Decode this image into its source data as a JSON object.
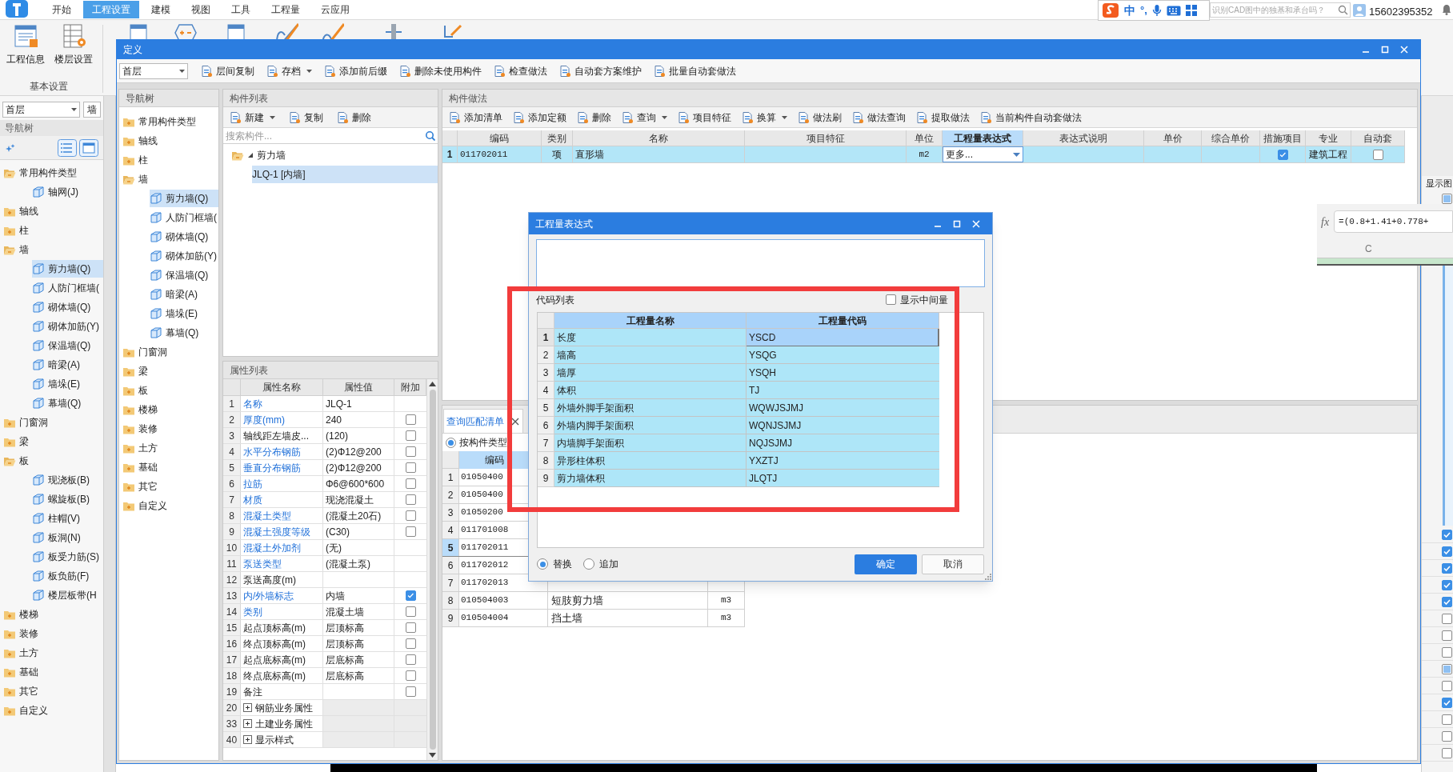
{
  "app": {
    "ribbon_tabs": [
      {
        "label": "开始",
        "selected": false
      },
      {
        "label": "工程设置",
        "selected": true
      },
      {
        "label": "建模",
        "selected": false
      },
      {
        "label": "视图",
        "selected": false
      },
      {
        "label": "工具",
        "selected": false
      },
      {
        "label": "工程量",
        "selected": false
      },
      {
        "label": "云应用",
        "selected": false
      }
    ],
    "ribbon_buttons": [
      {
        "label": "工程信息"
      },
      {
        "label": "楼层设置"
      }
    ],
    "ribbon_group": "基本设置",
    "ime": {
      "language": "中",
      "punctuation": "°,"
    },
    "help_search": {
      "placeholder": "识别CAD图中的独基和承台吗？"
    },
    "user": "15602395352",
    "floor_select": "首层",
    "type_field": "墙",
    "nav_title": "导航树",
    "nav_tree": [
      {
        "label": "常用构件类型",
        "expanded": true,
        "children": [
          {
            "label": "轴网(J)",
            "selected": false
          }
        ]
      },
      {
        "label": "轴线",
        "expanded": false
      },
      {
        "label": "柱",
        "expanded": false
      },
      {
        "label": "墙",
        "expanded": true,
        "children": [
          {
            "label": "剪力墙(Q)",
            "selected": true
          },
          {
            "label": "人防门框墙(",
            "selected": false
          },
          {
            "label": "砌体墙(Q)",
            "selected": false
          },
          {
            "label": "砌体加筋(Y)",
            "selected": false
          },
          {
            "label": "保温墙(Q)",
            "selected": false
          },
          {
            "label": "暗梁(A)",
            "selected": false
          },
          {
            "label": "墙垛(E)",
            "selected": false
          },
          {
            "label": "幕墙(Q)",
            "selected": false
          }
        ]
      },
      {
        "label": "门窗洞",
        "expanded": false
      },
      {
        "label": "梁",
        "expanded": false
      },
      {
        "label": "板",
        "expanded": true,
        "children": [
          {
            "label": "现浇板(B)",
            "selected": false
          },
          {
            "label": "螺旋板(B)",
            "selected": false
          },
          {
            "label": "柱帽(V)",
            "selected": false
          },
          {
            "label": "板洞(N)",
            "selected": false
          },
          {
            "label": "板受力筋(S)",
            "selected": false
          },
          {
            "label": "板负筋(F)",
            "selected": false
          },
          {
            "label": "楼层板带(H",
            "selected": false
          }
        ]
      },
      {
        "label": "楼梯",
        "expanded": false
      },
      {
        "label": "装修",
        "expanded": false
      },
      {
        "label": "土方",
        "expanded": false
      },
      {
        "label": "基础",
        "expanded": false
      },
      {
        "label": "其它",
        "expanded": false
      },
      {
        "label": "自定义",
        "expanded": false
      }
    ]
  },
  "define_window": {
    "title": "定义",
    "floor_select": "首层",
    "toolbar": [
      {
        "label": "层间复制",
        "dropdown": false
      },
      {
        "label": "存档",
        "dropdown": true
      },
      {
        "label": "添加前后缀",
        "dropdown": false
      },
      {
        "label": "删除未使用构件",
        "dropdown": false
      },
      {
        "label": "检查做法",
        "dropdown": false
      },
      {
        "label": "自动套方案维护",
        "dropdown": false
      },
      {
        "label": "批量自动套做法",
        "dropdown": false
      }
    ],
    "nav_title": "导航树",
    "nav_tree": [
      {
        "label": "常用构件类型",
        "expanded": false
      },
      {
        "label": "轴线",
        "expanded": false
      },
      {
        "label": "柱",
        "expanded": false
      },
      {
        "label": "墙",
        "expanded": true,
        "children": [
          {
            "label": "剪力墙(Q)",
            "selected": true
          },
          {
            "label": "人防门框墙(",
            "selected": false
          },
          {
            "label": "砌体墙(Q)",
            "selected": false
          },
          {
            "label": "砌体加筋(Y)",
            "selected": false
          },
          {
            "label": "保温墙(Q)",
            "selected": false
          },
          {
            "label": "暗梁(A)",
            "selected": false
          },
          {
            "label": "墙垛(E)",
            "selected": false
          },
          {
            "label": "幕墙(Q)",
            "selected": false
          }
        ]
      },
      {
        "label": "门窗洞",
        "expanded": false
      },
      {
        "label": "梁",
        "expanded": false
      },
      {
        "label": "板",
        "expanded": false
      },
      {
        "label": "楼梯",
        "expanded": false
      },
      {
        "label": "装修",
        "expanded": false
      },
      {
        "label": "土方",
        "expanded": false
      },
      {
        "label": "基础",
        "expanded": false
      },
      {
        "label": "其它",
        "expanded": false
      },
      {
        "label": "自定义",
        "expanded": false
      }
    ],
    "component_list": {
      "title": "构件列表",
      "toolbar": [
        {
          "label": "新建",
          "dropdown": true
        },
        {
          "label": "复制",
          "dropdown": false
        },
        {
          "label": "删除",
          "dropdown": false
        }
      ],
      "search": {
        "placeholder": "搜索构件..."
      },
      "tree": [
        {
          "label": "剪力墙",
          "expanded": true,
          "children": [
            {
              "label": "JLQ-1 [内墙]",
              "selected": true
            }
          ]
        }
      ]
    },
    "properties": {
      "title": "属性列表",
      "columns": [
        "属性名称",
        "属性值",
        "附加"
      ],
      "rows": [
        {
          "no": "1",
          "kind": "plain",
          "name": "名称",
          "public": true,
          "value": "JLQ-1"
        },
        {
          "no": "2",
          "kind": "check",
          "name": "厚度(mm)",
          "public": true,
          "value": "240",
          "checked": false
        },
        {
          "no": "3",
          "kind": "check",
          "name": "轴线距左墙皮...",
          "public": false,
          "value": "(120)",
          "checked": false
        },
        {
          "no": "4",
          "kind": "check",
          "name": "水平分布钢筋",
          "public": true,
          "value": "(2)Φ12@200",
          "checked": false
        },
        {
          "no": "5",
          "kind": "check",
          "name": "垂直分布钢筋",
          "public": true,
          "value": "(2)Φ12@200",
          "checked": false
        },
        {
          "no": "6",
          "kind": "check",
          "name": "拉筋",
          "public": true,
          "value": "Φ6@600*600",
          "checked": false
        },
        {
          "no": "7",
          "kind": "check",
          "name": "材质",
          "public": true,
          "value": "现浇混凝土",
          "checked": false
        },
        {
          "no": "8",
          "kind": "check",
          "name": "混凝土类型",
          "public": true,
          "value": "(混凝土20石)",
          "checked": false
        },
        {
          "no": "9",
          "kind": "check",
          "name": "混凝土强度等级",
          "public": true,
          "value": "(C30)",
          "checked": false
        },
        {
          "no": "10",
          "kind": "plain",
          "name": "混凝土外加剂",
          "public": true,
          "value": "(无)"
        },
        {
          "no": "11",
          "kind": "plain",
          "name": "泵送类型",
          "public": true,
          "value": "(混凝土泵)"
        },
        {
          "no": "12",
          "kind": "plain",
          "name": "泵送高度(m)",
          "public": false
        },
        {
          "no": "13",
          "kind": "check",
          "name": "内/外墙标志",
          "public": true,
          "value": "内墙",
          "checked": true
        },
        {
          "no": "14",
          "kind": "check",
          "name": "类别",
          "public": true,
          "value": "混凝土墙",
          "checked": false
        },
        {
          "no": "15",
          "kind": "check",
          "name": "起点顶标高(m)",
          "public": false,
          "value": "层顶标高",
          "checked": false
        },
        {
          "no": "16",
          "kind": "check",
          "name": "终点顶标高(m)",
          "public": false,
          "value": "层顶标高",
          "checked": false
        },
        {
          "no": "17",
          "kind": "check",
          "name": "起点底标高(m)",
          "public": false,
          "value": "层底标高",
          "checked": false
        },
        {
          "no": "18",
          "kind": "check",
          "name": "终点底标高(m)",
          "public": false,
          "value": "层底标高",
          "checked": false
        },
        {
          "no": "19",
          "kind": "check",
          "name": "备注",
          "public": false,
          "checked": false
        },
        {
          "no": "20",
          "kind": "group",
          "name": "钢筋业务属性",
          "public": false
        },
        {
          "no": "33",
          "kind": "group",
          "name": "土建业务属性",
          "public": false
        },
        {
          "no": "40",
          "kind": "group",
          "name": "显示样式",
          "public": false
        }
      ]
    },
    "methods": {
      "title": "构件做法",
      "toolbar": [
        {
          "label": "添加清单",
          "dropdown": false
        },
        {
          "label": "添加定额",
          "dropdown": false
        },
        {
          "label": "删除",
          "dropdown": false
        },
        {
          "label": "查询",
          "dropdown": true
        },
        {
          "label": "项目特征",
          "dropdown": false
        },
        {
          "label": "换算",
          "dropdown": true
        },
        {
          "label": "做法刷",
          "dropdown": false
        },
        {
          "label": "做法查询",
          "dropdown": false
        },
        {
          "label": "提取做法",
          "dropdown": false
        },
        {
          "label": "当前构件自动套做法",
          "dropdown": false
        }
      ],
      "columns": [
        {
          "label": "编码",
          "selected": false
        },
        {
          "label": "类别",
          "selected": false
        },
        {
          "label": "名称",
          "selected": false
        },
        {
          "label": "项目特征",
          "selected": false
        },
        {
          "label": "单位",
          "selected": false
        },
        {
          "label": "工程量表达式",
          "selected": true
        },
        {
          "label": "表达式说明",
          "selected": false
        },
        {
          "label": "单价",
          "selected": false
        },
        {
          "label": "综合单价",
          "selected": false
        },
        {
          "label": "措施项目",
          "selected": false
        },
        {
          "label": "专业",
          "selected": false
        },
        {
          "label": "自动套",
          "selected": false
        }
      ],
      "rows": [
        {
          "no": "1",
          "selected": true,
          "code": "011702011",
          "category": "项",
          "name": "直形墙",
          "unit": "m2",
          "expression": "更多...",
          "measure": true,
          "specialty": "建筑工程",
          "auto": false
        }
      ]
    },
    "query": {
      "tab": "查询匹配清单",
      "filter": {
        "label": "按构件类型",
        "selected": true
      },
      "columns": [
        "编码"
      ],
      "rows": [
        {
          "no": "1",
          "code": "01050400",
          "selected": false
        },
        {
          "no": "2",
          "code": "01050400",
          "selected": false
        },
        {
          "no": "3",
          "code": "01050200",
          "selected": false
        },
        {
          "no": "4",
          "code": "011701008",
          "selected": false
        },
        {
          "no": "5",
          "code": "011702011",
          "selected": true
        },
        {
          "no": "6",
          "code": "011702012",
          "selected": false
        },
        {
          "no": "7",
          "code": "011702013",
          "selected": false
        },
        {
          "no": "8",
          "code": "010504003",
          "name": "短肢剪力墙",
          "unit": "m3",
          "selected": false
        },
        {
          "no": "9",
          "code": "010504004",
          "name": "挡土墙",
          "unit": "m3",
          "selected": false
        }
      ]
    }
  },
  "expression_dialog": {
    "title": "工程量表达式",
    "code_list_title": "代码列表",
    "show_intermediate": {
      "label": "显示中间量",
      "checked": false
    },
    "columns": [
      "工程量名称",
      "工程量代码"
    ],
    "rows": [
      {
        "no": "1",
        "name": "长度",
        "code": "YSCD",
        "selected": true
      },
      {
        "no": "2",
        "name": "墙高",
        "code": "YSQG",
        "selected": false
      },
      {
        "no": "3",
        "name": "墙厚",
        "code": "YSQH",
        "selected": false
      },
      {
        "no": "4",
        "name": "体积",
        "code": "TJ",
        "selected": false
      },
      {
        "no": "5",
        "name": "外墙外脚手架面积",
        "code": "WQWJSJMJ",
        "selected": false
      },
      {
        "no": "6",
        "name": "外墙内脚手架面积",
        "code": "WQNJSJMJ",
        "selected": false
      },
      {
        "no": "7",
        "name": "内墙脚手架面积",
        "code": "NQJSJMJ",
        "selected": false
      },
      {
        "no": "8",
        "name": "异形柱体积",
        "code": "YXZTJ",
        "selected": false
      },
      {
        "no": "9",
        "name": "剪力墙体积",
        "code": "JLQTJ",
        "selected": false
      }
    ],
    "modes": [
      {
        "label": "替换",
        "selected": true
      },
      {
        "label": "追加",
        "selected": false
      }
    ],
    "buttons": [
      {
        "label": "确定",
        "primary": true
      },
      {
        "label": "取消",
        "primary": false
      }
    ]
  },
  "side_panel": {
    "column_title": "显示图",
    "top_check": {
      "checked": false,
      "indeterminate": true
    },
    "checks": [
      {
        "checked": true,
        "indeterminate": false
      },
      {
        "checked": true,
        "indeterminate": false
      },
      {
        "checked": true,
        "indeterminate": false
      },
      {
        "checked": true,
        "indeterminate": false
      },
      {
        "checked": true,
        "indeterminate": false
      },
      {
        "checked": false,
        "indeterminate": false
      },
      {
        "checked": false,
        "indeterminate": false
      },
      {
        "checked": false,
        "indeterminate": false
      },
      {
        "checked": false,
        "indeterminate": true
      },
      {
        "checked": false,
        "indeterminate": false
      },
      {
        "checked": true,
        "indeterminate": false
      },
      {
        "checked": false,
        "indeterminate": false
      },
      {
        "checked": false,
        "indeterminate": false
      },
      {
        "checked": false,
        "indeterminate": false
      }
    ]
  },
  "formula_popup": {
    "label": "fx",
    "formula": "=(0.8+1.41+0.778+",
    "column": "C"
  }
}
